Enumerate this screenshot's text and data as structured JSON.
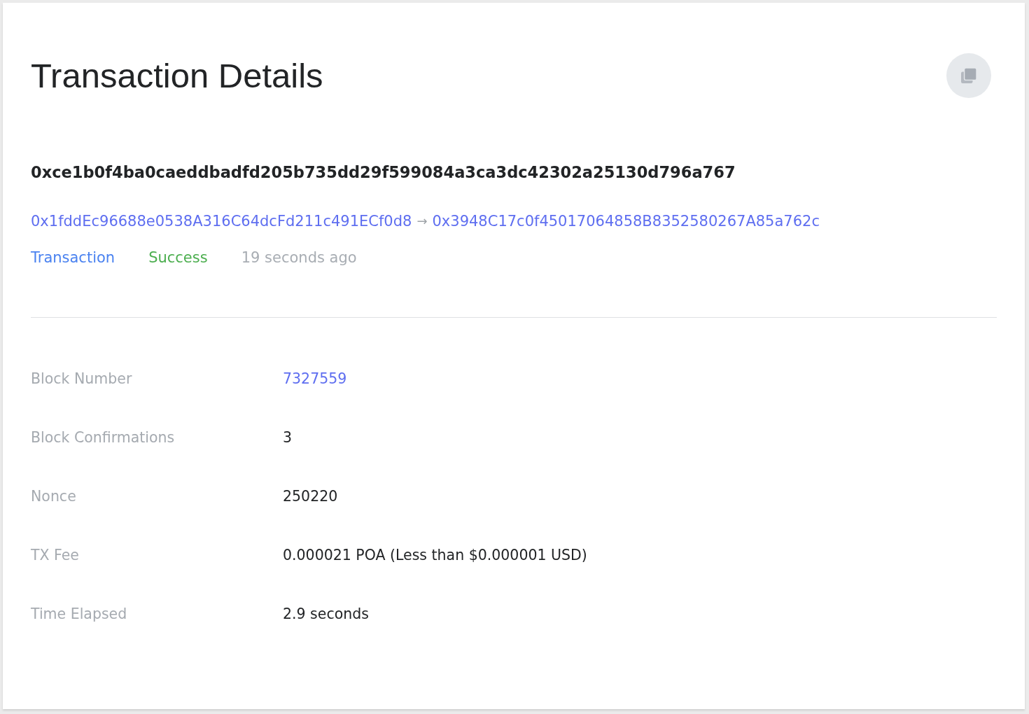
{
  "header": {
    "title": "Transaction Details"
  },
  "transaction": {
    "hash": "0xce1b0f4ba0caeddbadfd205b735dd29f599084a3ca3dc42302a25130d796a767",
    "from": "0x1fddEc96688e0538A316C64dcFd211c491ECf0d8",
    "arrow": "→",
    "to": "0x3948C17c0f45017064858B8352580267A85a762c",
    "type": "Transaction",
    "status": {
      "label": "Success",
      "kind": "success"
    },
    "age": "19 seconds ago"
  },
  "details": [
    {
      "label": "Block Number",
      "value": "7327559",
      "kind": "link"
    },
    {
      "label": "Block Confirmations",
      "value": "3",
      "kind": "text"
    },
    {
      "label": "Nonce",
      "value": "250220",
      "kind": "text"
    },
    {
      "label": "TX Fee",
      "value": "0.000021 POA (Less than $0.000001 USD)",
      "kind": "text"
    },
    {
      "label": "Time Elapsed",
      "value": "2.9 seconds",
      "kind": "text"
    }
  ]
}
